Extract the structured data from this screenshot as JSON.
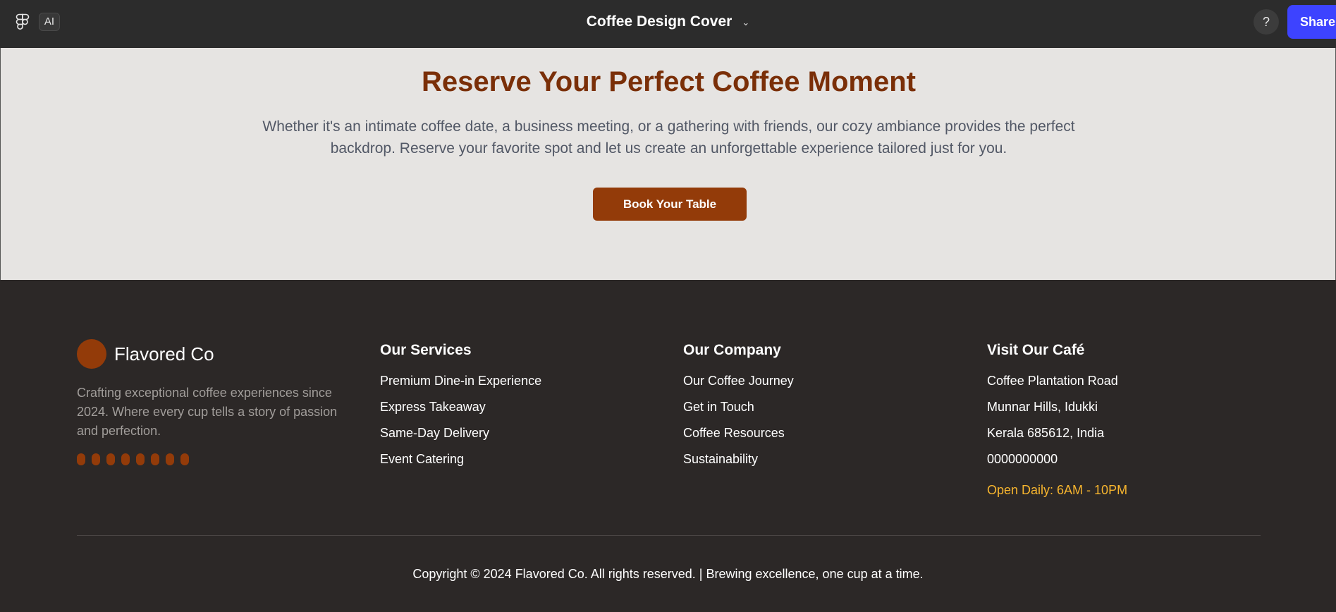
{
  "topbar": {
    "ai_label": "AI",
    "file_title": "Coffee Design Cover",
    "help_label": "?",
    "share_label": "Share"
  },
  "hero": {
    "title": "Reserve Your Perfect Coffee Moment",
    "description": "Whether it's an intimate coffee date, a business meeting, or a gathering with friends, our cozy ambiance provides the perfect backdrop. Reserve your favorite spot and let us create an unforgettable experience tailored just for you.",
    "button_label": "Book Your Table"
  },
  "footer": {
    "brand": {
      "name": "Flavored Co",
      "description": "Crafting exceptional coffee experiences since 2024. Where every cup tells a story of passion and perfection."
    },
    "services": {
      "title": "Our Services",
      "items": [
        "Premium Dine-in Experience",
        "Express Takeaway",
        "Same-Day Delivery",
        "Event Catering"
      ]
    },
    "company": {
      "title": "Our Company",
      "items": [
        "Our Coffee Journey",
        "Get in Touch",
        "Coffee Resources",
        "Sustainability"
      ]
    },
    "visit": {
      "title": "Visit Our Café",
      "items": [
        "Coffee Plantation Road",
        "Munnar Hills, Idukki",
        "Kerala 685612, India",
        "0000000000"
      ],
      "hours": "Open Daily: 6AM - 10PM"
    },
    "copyright": "Copyright © 2024 Flavored Co. All rights reserved. | Brewing excellence, one cup at a time."
  },
  "colors": {
    "accent": "#933b09",
    "hero_title": "#7a2f08",
    "share": "#3d43ff",
    "hours": "#f7b52e"
  }
}
